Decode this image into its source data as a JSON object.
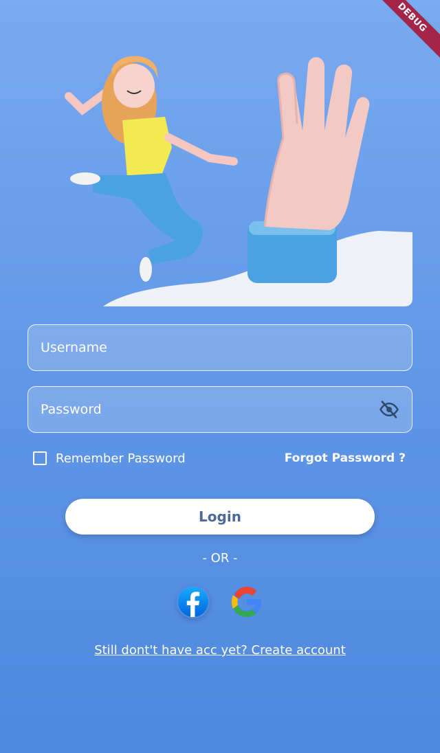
{
  "debug_banner": "DEBUG",
  "username": {
    "placeholder": "Username"
  },
  "password": {
    "placeholder": "Password",
    "visibility_icon": "eye-off-icon"
  },
  "remember": {
    "label": "Remember Password",
    "checked": false
  },
  "forgot_label": "Forgot Password ?",
  "login_label": "Login",
  "or_label": "- OR -",
  "social": [
    {
      "name": "facebook",
      "icon": "facebook-icon",
      "color": "#1877f2"
    },
    {
      "name": "google",
      "icon": "google-icon"
    }
  ],
  "create_account_label": "Still dont't have acc yet? Create account"
}
